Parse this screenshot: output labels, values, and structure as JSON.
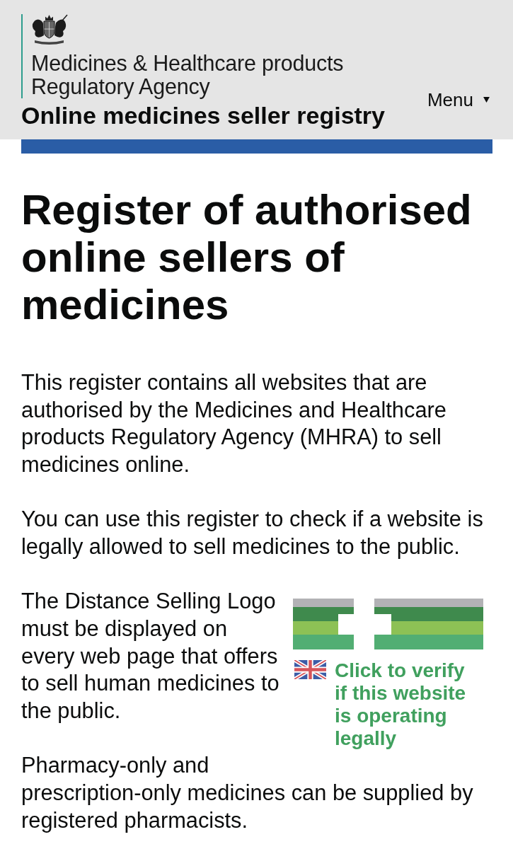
{
  "header": {
    "agency_name": [
      "Medicines & Healthcare products",
      "Regulatory Agency"
    ],
    "service_name": "Online medicines seller registry",
    "menu": {
      "label": "Menu"
    }
  },
  "heading": "Register of authorised online sellers of medicines",
  "paragraphs": [
    {
      "text": "This register contains all websites that are authorised by the Medicines and Healthcare products Regulatory Agency (MHRA) to sell medicines online."
    },
    {
      "text": "You can use this register to check if a website is legally allowed to sell medicines to the public."
    },
    {
      "text": "The Distance Selling Logo must be displayed on every web page that offers to sell human medicines to the public.",
      "badge": {
        "caption": "Click to verify if this website is operating legally"
      }
    },
    {
      "text": "Pharmacy-only and prescription-only medicines can be supplied by registered pharmacists."
    }
  ]
}
